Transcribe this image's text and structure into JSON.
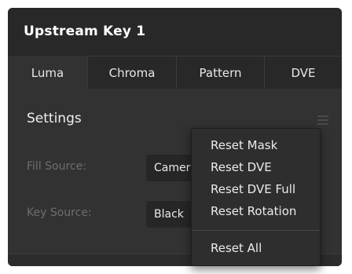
{
  "panel": {
    "title": "Upstream Key 1"
  },
  "tabs": [
    {
      "label": "Luma"
    },
    {
      "label": "Chroma"
    },
    {
      "label": "Pattern"
    },
    {
      "label": "DVE"
    }
  ],
  "settings": {
    "title": "Settings",
    "fill_source_label": "Fill Source:",
    "fill_source_value": "Camera",
    "key_source_label": "Key Source:",
    "key_source_value": "Black"
  },
  "dropdown": {
    "items": [
      {
        "label": "Reset Mask"
      },
      {
        "label": "Reset DVE"
      },
      {
        "label": "Reset DVE Full"
      },
      {
        "label": "Reset Rotation"
      }
    ],
    "reset_all_label": "Reset All"
  },
  "colors": {
    "panel_bg": "#323232",
    "header_bg": "#282828",
    "muted_label": "#6e6e6e"
  }
}
